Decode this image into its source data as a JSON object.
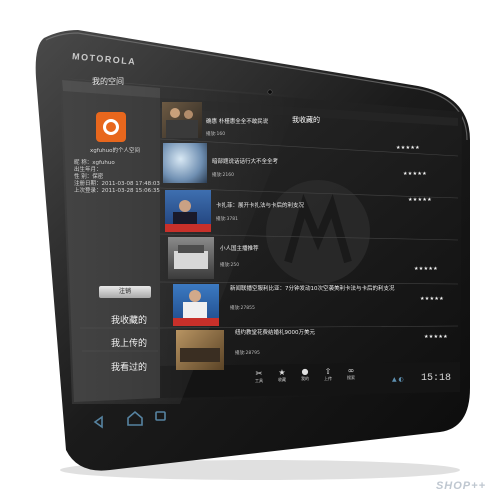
{
  "device": {
    "brand": "MOTOROLA",
    "watermark": "SHOP++"
  },
  "left_panel": {
    "title": "我的空间",
    "avatar": "app-logo-icon",
    "username": "xgfuhuo的个人空间",
    "info": [
      {
        "label": "昵  称：",
        "value": "xgfuhuo"
      },
      {
        "label": "出生年月：",
        "value": ""
      },
      {
        "label": "性  别：",
        "value": "保密"
      },
      {
        "label": "注册日期：",
        "value": "2011-03-08 17:48:03"
      },
      {
        "label": "上次登录：",
        "value": "2011-03-28 15:06:35"
      }
    ],
    "logout_label": "注销",
    "links": [
      "我收藏的",
      "我上传的",
      "我看过的"
    ]
  },
  "right_panel": {
    "header": "我收藏的",
    "rating": "★★★★★",
    "items": [
      {
        "title": "确惠 朴槿惠全全不敢民说",
        "meta": "播放:160"
      },
      {
        "title": "暗部题说话话行大不全全考",
        "meta": "播放:2160"
      },
      {
        "title": "卡扎菲：展开卡扎法与卡后的利支况",
        "meta": "播放:3781"
      },
      {
        "title": "小人国主播推荐",
        "meta": "播放:250"
      },
      {
        "title": "新闻联播空服利比亚：7分钟发动10次空袭美利卡法与卡后的利支况",
        "meta": "播放:27855"
      },
      {
        "title": "纽约教堂花费结婚礼9000万美元",
        "meta": "播放:28795"
      }
    ]
  },
  "bottom_bar": {
    "buttons": [
      {
        "icon": "tools-icon",
        "label": "工具"
      },
      {
        "icon": "star-icon",
        "label": "收藏"
      },
      {
        "icon": "person-icon",
        "label": "我的"
      },
      {
        "icon": "upload-icon",
        "label": "上传"
      },
      {
        "icon": "binoculars-icon",
        "label": "搜索"
      }
    ],
    "time": "15:18"
  },
  "system_bar": {
    "icons": [
      "back-icon",
      "home-icon",
      "recent-apps-icon"
    ]
  }
}
